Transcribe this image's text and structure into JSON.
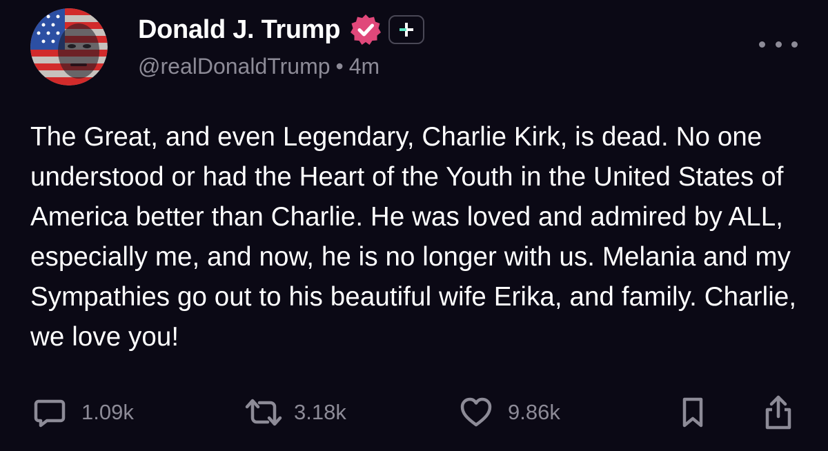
{
  "author": {
    "display_name": "Donald J. Trump",
    "handle": "@realDonaldTrump",
    "separator": "•",
    "time_ago": "4m",
    "verified_badge_color": "#e0487a"
  },
  "post": {
    "text": "The Great, and even Legendary, Charlie Kirk, is dead. No one understood or had the Heart of the Youth in the United States of America better than Charlie. He was loved and admired by ALL, especially me, and now, he is no longer with us. Melania and my Sympathies go out to his beautiful wife Erika, and family. Charlie, we love you!"
  },
  "actions": {
    "replies": "1.09k",
    "reposts": "3.18k",
    "likes": "9.86k"
  },
  "icons": {
    "follow": "plus-icon",
    "more": "more-dots-icon",
    "reply": "comment-icon",
    "repost": "repost-icon",
    "like": "heart-icon",
    "bookmark": "bookmark-icon",
    "share": "share-icon"
  },
  "colors": {
    "background": "#0b0915",
    "text": "#ffffff",
    "muted": "#8d8b97",
    "accent": "#e0487a",
    "follow_accent": "#5ee6c4"
  }
}
